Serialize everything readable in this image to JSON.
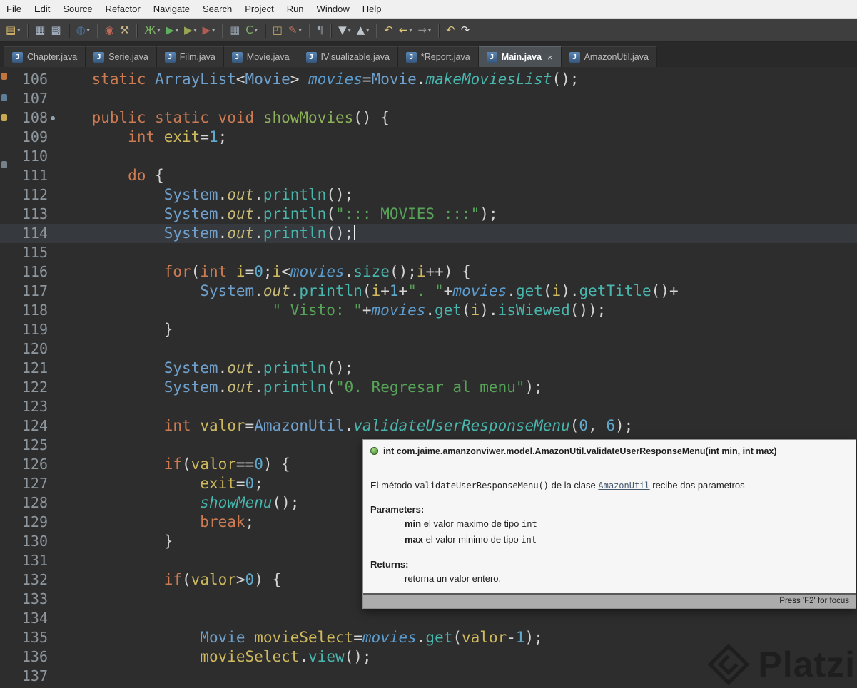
{
  "menu": {
    "items": [
      "File",
      "Edit",
      "Source",
      "Refactor",
      "Navigate",
      "Search",
      "Project",
      "Run",
      "Window",
      "Help"
    ]
  },
  "toolbar": {
    "groups": [
      [
        {
          "id": "new-wizard",
          "glyph": "▤",
          "color": "#D9B96C",
          "dd": true
        }
      ],
      [
        {
          "id": "save",
          "glyph": "▦",
          "color": "#A8B8C8",
          "dd": false
        },
        {
          "id": "save-all",
          "glyph": "▩",
          "color": "#A8B8C8",
          "dd": false
        }
      ],
      [
        {
          "id": "publish-sphere",
          "glyph": "◍",
          "color": "#50749C",
          "dd": true
        }
      ],
      [
        {
          "id": "skip-breakpoints",
          "glyph": "◉",
          "color": "#C06A5A",
          "dd": false
        },
        {
          "id": "build",
          "glyph": "⚒",
          "color": "#C9B68A",
          "dd": false
        }
      ],
      [
        {
          "id": "debug",
          "glyph": "Ж",
          "color": "#7CB661",
          "dd": true
        },
        {
          "id": "run",
          "glyph": "▶",
          "color": "#5FAF5F",
          "dd": true
        },
        {
          "id": "coverage",
          "glyph": "▶",
          "color": "#9AA653",
          "dd": true
        },
        {
          "id": "profile",
          "glyph": "▶",
          "color": "#B25B50",
          "dd": true
        }
      ],
      [
        {
          "id": "coverage-grid",
          "glyph": "▦",
          "color": "#8E9AA6",
          "dd": false
        },
        {
          "id": "new-class",
          "glyph": "C",
          "color": "#7FB069",
          "dd": true
        }
      ],
      [
        {
          "id": "open-type",
          "glyph": "◰",
          "color": "#C2A66B",
          "dd": false
        },
        {
          "id": "brush",
          "glyph": "✎",
          "color": "#B8705E",
          "dd": true
        }
      ],
      [
        {
          "id": "show-whitespace",
          "glyph": "¶",
          "color": "#9FA9B2",
          "dd": false
        }
      ],
      [
        {
          "id": "next-annotation",
          "glyph": "▼",
          "color": "#BFC6CC",
          "dd": true
        },
        {
          "id": "prev-annotation",
          "glyph": "▲",
          "color": "#BFC6CC",
          "dd": true
        }
      ],
      [
        {
          "id": "last-edit-location",
          "glyph": "↶",
          "color": "#D9C27A",
          "dd": false
        },
        {
          "id": "back-history",
          "glyph": "←",
          "color": "#E0C878",
          "dd": true
        },
        {
          "id": "forward-history",
          "glyph": "→",
          "color": "#8F8F8F",
          "dd": true
        }
      ],
      [
        {
          "id": "undo",
          "glyph": "↶",
          "color": "#D9C27A",
          "dd": false
        },
        {
          "id": "redo",
          "glyph": "↷",
          "color": "#E8E8E8",
          "dd": false
        }
      ]
    ]
  },
  "tabs_close_glyph": "×",
  "tabs": [
    {
      "label": "Chapter.java",
      "active": false,
      "close": false
    },
    {
      "label": "Serie.java",
      "active": false,
      "close": false
    },
    {
      "label": "Film.java",
      "active": false,
      "close": false
    },
    {
      "label": "Movie.java",
      "active": false,
      "close": false
    },
    {
      "label": "IVisualizable.java",
      "active": false,
      "close": false
    },
    {
      "label": "*Report.java",
      "active": false,
      "close": false
    },
    {
      "label": "Main.java",
      "active": true,
      "close": true
    },
    {
      "label": "AmazonUtil.java",
      "active": false,
      "close": false
    }
  ],
  "editor": {
    "lines": [
      {
        "n": 106,
        "seg": [
          [
            "pl",
            "    "
          ],
          [
            "kw",
            "static"
          ],
          [
            "pl",
            " "
          ],
          [
            "ty",
            "ArrayList"
          ],
          [
            "pl",
            "<"
          ],
          [
            "ty",
            "Movie"
          ],
          [
            "pl",
            "> "
          ],
          [
            "fd",
            "movies"
          ],
          [
            "pl",
            "="
          ],
          [
            "ty",
            "Movie"
          ],
          [
            "pl",
            "."
          ],
          [
            "mi",
            "makeMoviesList"
          ],
          [
            "pl",
            "();"
          ]
        ]
      },
      {
        "n": 107,
        "seg": []
      },
      {
        "n": 108,
        "dot": true,
        "seg": [
          [
            "pl",
            "    "
          ],
          [
            "kw",
            "public"
          ],
          [
            "pl",
            " "
          ],
          [
            "kw",
            "static"
          ],
          [
            "pl",
            " "
          ],
          [
            "kw",
            "void"
          ],
          [
            "pl",
            " "
          ],
          [
            "md",
            "showMovies"
          ],
          [
            "pl",
            "() {"
          ]
        ]
      },
      {
        "n": 109,
        "seg": [
          [
            "pl",
            "        "
          ],
          [
            "kw",
            "int"
          ],
          [
            "pl",
            " "
          ],
          [
            "va",
            "exit"
          ],
          [
            "pl",
            "="
          ],
          [
            "nu",
            "1"
          ],
          [
            "pl",
            ";"
          ]
        ]
      },
      {
        "n": 110,
        "seg": []
      },
      {
        "n": 111,
        "seg": [
          [
            "pl",
            "        "
          ],
          [
            "kw",
            "do"
          ],
          [
            "pl",
            " {"
          ]
        ]
      },
      {
        "n": 112,
        "seg": [
          [
            "pl",
            "            "
          ],
          [
            "ty",
            "System"
          ],
          [
            "pl",
            "."
          ],
          [
            "fo",
            "out"
          ],
          [
            "pl",
            "."
          ],
          [
            "me",
            "println"
          ],
          [
            "pl",
            "();"
          ]
        ]
      },
      {
        "n": 113,
        "seg": [
          [
            "pl",
            "            "
          ],
          [
            "ty",
            "System"
          ],
          [
            "pl",
            "."
          ],
          [
            "fo",
            "out"
          ],
          [
            "pl",
            "."
          ],
          [
            "me",
            "println"
          ],
          [
            "pl",
            "("
          ],
          [
            "st",
            "\"::: MOVIES :::\""
          ],
          [
            "pl",
            ");"
          ]
        ]
      },
      {
        "n": 114,
        "cur": true,
        "seg": [
          [
            "pl",
            "            "
          ],
          [
            "ty",
            "System"
          ],
          [
            "pl",
            "."
          ],
          [
            "fo",
            "out"
          ],
          [
            "pl",
            "."
          ],
          [
            "me",
            "println"
          ],
          [
            "pl",
            "();"
          ]
        ]
      },
      {
        "n": 115,
        "seg": []
      },
      {
        "n": 116,
        "seg": [
          [
            "pl",
            "            "
          ],
          [
            "kw",
            "for"
          ],
          [
            "pl",
            "("
          ],
          [
            "kw",
            "int"
          ],
          [
            "pl",
            " "
          ],
          [
            "va",
            "i"
          ],
          [
            "pl",
            "="
          ],
          [
            "nu",
            "0"
          ],
          [
            "pl",
            ";"
          ],
          [
            "va",
            "i"
          ],
          [
            "pl",
            "<"
          ],
          [
            "fd",
            "movies"
          ],
          [
            "pl",
            "."
          ],
          [
            "me",
            "size"
          ],
          [
            "pl",
            "();"
          ],
          [
            "va",
            "i"
          ],
          [
            "pl",
            "++) {"
          ]
        ]
      },
      {
        "n": 117,
        "seg": [
          [
            "pl",
            "                "
          ],
          [
            "ty",
            "System"
          ],
          [
            "pl",
            "."
          ],
          [
            "fo",
            "out"
          ],
          [
            "pl",
            "."
          ],
          [
            "me",
            "println"
          ],
          [
            "pl",
            "("
          ],
          [
            "va",
            "i"
          ],
          [
            "pl",
            "+"
          ],
          [
            "nu",
            "1"
          ],
          [
            "pl",
            "+"
          ],
          [
            "st",
            "\". \""
          ],
          [
            "pl",
            "+"
          ],
          [
            "fd",
            "movies"
          ],
          [
            "pl",
            "."
          ],
          [
            "me",
            "get"
          ],
          [
            "pl",
            "("
          ],
          [
            "va",
            "i"
          ],
          [
            "pl",
            ")."
          ],
          [
            "me",
            "getTitle"
          ],
          [
            "pl",
            "()+"
          ]
        ]
      },
      {
        "n": 118,
        "seg": [
          [
            "pl",
            "                        "
          ],
          [
            "st",
            "\" Visto: \""
          ],
          [
            "pl",
            "+"
          ],
          [
            "fd",
            "movies"
          ],
          [
            "pl",
            "."
          ],
          [
            "me",
            "get"
          ],
          [
            "pl",
            "("
          ],
          [
            "va",
            "i"
          ],
          [
            "pl",
            ")."
          ],
          [
            "me",
            "isWiewed"
          ],
          [
            "pl",
            "());"
          ]
        ]
      },
      {
        "n": 119,
        "seg": [
          [
            "pl",
            "            }"
          ]
        ]
      },
      {
        "n": 120,
        "seg": []
      },
      {
        "n": 121,
        "seg": [
          [
            "pl",
            "            "
          ],
          [
            "ty",
            "System"
          ],
          [
            "pl",
            "."
          ],
          [
            "fo",
            "out"
          ],
          [
            "pl",
            "."
          ],
          [
            "me",
            "println"
          ],
          [
            "pl",
            "();"
          ]
        ]
      },
      {
        "n": 122,
        "seg": [
          [
            "pl",
            "            "
          ],
          [
            "ty",
            "System"
          ],
          [
            "pl",
            "."
          ],
          [
            "fo",
            "out"
          ],
          [
            "pl",
            "."
          ],
          [
            "me",
            "println"
          ],
          [
            "pl",
            "("
          ],
          [
            "st",
            "\"0. Regresar al menu\""
          ],
          [
            "pl",
            ");"
          ]
        ]
      },
      {
        "n": 123,
        "seg": []
      },
      {
        "n": 124,
        "seg": [
          [
            "pl",
            "            "
          ],
          [
            "kw",
            "int"
          ],
          [
            "pl",
            " "
          ],
          [
            "va",
            "valor"
          ],
          [
            "pl",
            "="
          ],
          [
            "ty",
            "AmazonUtil"
          ],
          [
            "pl",
            "."
          ],
          [
            "mi",
            "validateUserResponseMenu"
          ],
          [
            "pl",
            "("
          ],
          [
            "nu",
            "0"
          ],
          [
            "pl",
            ", "
          ],
          [
            "nu",
            "6"
          ],
          [
            "pl",
            ");"
          ]
        ]
      },
      {
        "n": 125,
        "seg": []
      },
      {
        "n": 126,
        "seg": [
          [
            "pl",
            "            "
          ],
          [
            "kw",
            "if"
          ],
          [
            "pl",
            "("
          ],
          [
            "va",
            "valor"
          ],
          [
            "pl",
            "=="
          ],
          [
            "nu",
            "0"
          ],
          [
            "pl",
            ") {"
          ]
        ]
      },
      {
        "n": 127,
        "seg": [
          [
            "pl",
            "                "
          ],
          [
            "va",
            "exit"
          ],
          [
            "pl",
            "="
          ],
          [
            "nu",
            "0"
          ],
          [
            "pl",
            ";"
          ]
        ]
      },
      {
        "n": 128,
        "seg": [
          [
            "pl",
            "                "
          ],
          [
            "mi",
            "showMenu"
          ],
          [
            "pl",
            "();"
          ]
        ]
      },
      {
        "n": 129,
        "seg": [
          [
            "pl",
            "                "
          ],
          [
            "kw",
            "break"
          ],
          [
            "pl",
            ";"
          ]
        ]
      },
      {
        "n": 130,
        "seg": [
          [
            "pl",
            "            }"
          ]
        ]
      },
      {
        "n": 131,
        "seg": []
      },
      {
        "n": 132,
        "seg": [
          [
            "pl",
            "            "
          ],
          [
            "kw",
            "if"
          ],
          [
            "pl",
            "("
          ],
          [
            "va",
            "valor"
          ],
          [
            "pl",
            ">"
          ],
          [
            "nu",
            "0"
          ],
          [
            "pl",
            ") {"
          ]
        ]
      },
      {
        "n": 133,
        "seg": []
      },
      {
        "n": 134,
        "seg": []
      },
      {
        "n": 135,
        "seg": [
          [
            "pl",
            "                "
          ],
          [
            "ty",
            "Movie"
          ],
          [
            "pl",
            " "
          ],
          [
            "va",
            "movieSelect"
          ],
          [
            "pl",
            "="
          ],
          [
            "fd",
            "movies"
          ],
          [
            "pl",
            "."
          ],
          [
            "me",
            "get"
          ],
          [
            "pl",
            "("
          ],
          [
            "va",
            "valor"
          ],
          [
            "pl",
            "-"
          ],
          [
            "nu",
            "1"
          ],
          [
            "pl",
            ");"
          ]
        ]
      },
      {
        "n": 136,
        "seg": [
          [
            "pl",
            "                "
          ],
          [
            "va",
            "movieSelect"
          ],
          [
            "pl",
            "."
          ],
          [
            "me",
            "view"
          ],
          [
            "pl",
            "();"
          ]
        ]
      },
      {
        "n": 137,
        "seg": []
      }
    ]
  },
  "tooltip": {
    "header": "int com.jaime.amanzonviwer.model.AmazonUtil.validateUserResponseMenu(int min, int max)",
    "body": [
      [
        "t",
        "El método "
      ],
      [
        "code",
        "validateUserResponseMenu()"
      ],
      [
        "t",
        " de la clase "
      ],
      [
        "link",
        "AmazonUtil"
      ],
      [
        "t",
        " recibe dos parametros"
      ]
    ],
    "parameters_label": "Parameters:",
    "params": [
      {
        "name": "min",
        "desc": " el valor maximo de tipo ",
        "type": "int"
      },
      {
        "name": "max",
        "desc": " el valor minimo de tipo ",
        "type": "int"
      }
    ],
    "returns_label": "Returns:",
    "returns": "retorna un valor entero.",
    "footer": "Press 'F2' for focus"
  },
  "watermark": {
    "text": "Platzi"
  },
  "colors": {
    "editorBg": "#2D2D2D",
    "currentLine": "#36393E",
    "gutter": "#8E979E",
    "kw": "#CC7B52",
    "ty": "#6FA0CC",
    "me": "#49B6AE",
    "fd": "#5C9CCE",
    "fo": "#C8BC78",
    "md": "#8CB158",
    "va": "#CFB95D",
    "st": "#57A459",
    "nu": "#61A9CC",
    "pl": "#D4D4D4"
  }
}
